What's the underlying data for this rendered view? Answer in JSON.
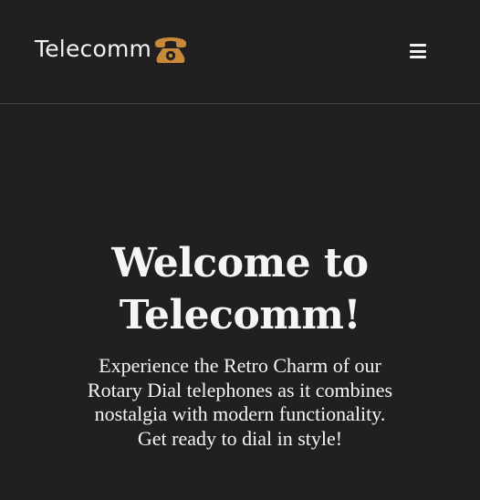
{
  "header": {
    "brand_text": "Telecomm",
    "brand_icon": "rotary-phone-icon",
    "menu_icon": "hamburger-menu-icon"
  },
  "hero": {
    "title_line1": "Welcome to",
    "title_line2": "Telecomm!",
    "subtitle_line1": "Experience the Retro Charm of our",
    "subtitle_line2": "Rotary Dial telephones as it combines",
    "subtitle_line3": "nostalgia with modern functionality.",
    "subtitle_line4": "Get ready to dial in style!"
  },
  "colors": {
    "background": "#211f20",
    "text": "#f5f5f5",
    "accent": "#c8893a",
    "divider": "#4a4748"
  }
}
